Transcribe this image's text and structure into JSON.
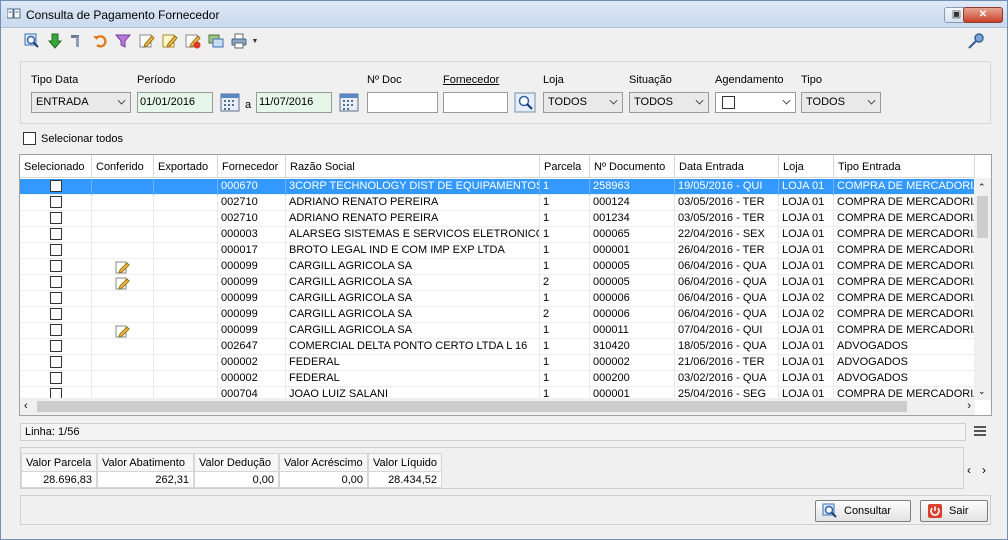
{
  "window": {
    "title": "Consulta de Pagamento Fornecedor"
  },
  "filters": {
    "tipo_data": {
      "label": "Tipo Data",
      "value": "ENTRADA"
    },
    "periodo": {
      "label": "Período",
      "from": "01/01/2016",
      "sep": "a",
      "to": "11/07/2016"
    },
    "n_doc": {
      "label": "Nº Doc",
      "value": ""
    },
    "fornecedor": {
      "label": "Fornecedor",
      "value": ""
    },
    "loja": {
      "label": "Loja",
      "value": "TODOS"
    },
    "situacao": {
      "label": "Situação",
      "value": "TODOS"
    },
    "agendamento": {
      "label": "Agendamento",
      "value": ""
    },
    "tipo": {
      "label": "Tipo",
      "value": "TODOS"
    }
  },
  "select_all": {
    "label": "Selecionar todos"
  },
  "grid": {
    "columns": [
      "Selecionado",
      "Conferido",
      "Exportado",
      "Fornecedor",
      "Razão Social",
      "Parcela",
      "Nº Documento",
      "Data Entrada",
      "Loja",
      "Tipo Entrada"
    ],
    "rows": [
      {
        "conferido": false,
        "fornecedor": "000670",
        "razao": "3CORP TECHNOLOGY DIST DE EQUIPAMENTOS",
        "parcela": "1",
        "doc": "258963",
        "data": "19/05/2016 - QUI",
        "loja": "LOJA 01",
        "tipo": "COMPRA DE MERCADORIAS"
      },
      {
        "conferido": false,
        "fornecedor": "002710",
        "razao": "ADRIANO RENATO PEREIRA",
        "parcela": "1",
        "doc": "000124",
        "data": "03/05/2016 - TER",
        "loja": "LOJA 01",
        "tipo": "COMPRA DE MERCADORIAS"
      },
      {
        "conferido": false,
        "fornecedor": "002710",
        "razao": "ADRIANO RENATO PEREIRA",
        "parcela": "1",
        "doc": "001234",
        "data": "03/05/2016 - TER",
        "loja": "LOJA 01",
        "tipo": "COMPRA DE MERCADORIAS"
      },
      {
        "conferido": false,
        "fornecedor": "000003",
        "razao": "ALARSEG SISTEMAS E SERVICOS ELETRONICOS",
        "parcela": "1",
        "doc": "000065",
        "data": "22/04/2016 - SEX",
        "loja": "LOJA 01",
        "tipo": "COMPRA DE MERCADORIAS"
      },
      {
        "conferido": false,
        "fornecedor": "000017",
        "razao": "BROTO LEGAL IND E COM IMP EXP LTDA",
        "parcela": "1",
        "doc": "000001",
        "data": "26/04/2016 - TER",
        "loja": "LOJA 01",
        "tipo": "COMPRA DE MERCADORIAS"
      },
      {
        "conferido": true,
        "fornecedor": "000099",
        "razao": "CARGILL AGRICOLA SA",
        "parcela": "1",
        "doc": "000005",
        "data": "06/04/2016 - QUA",
        "loja": "LOJA 01",
        "tipo": "COMPRA DE MERCADORIAS"
      },
      {
        "conferido": true,
        "fornecedor": "000099",
        "razao": "CARGILL AGRICOLA SA",
        "parcela": "2",
        "doc": "000005",
        "data": "06/04/2016 - QUA",
        "loja": "LOJA 01",
        "tipo": "COMPRA DE MERCADORIAS"
      },
      {
        "conferido": false,
        "fornecedor": "000099",
        "razao": "CARGILL AGRICOLA SA",
        "parcela": "1",
        "doc": "000006",
        "data": "06/04/2016 - QUA",
        "loja": "LOJA 02",
        "tipo": "COMPRA DE MERCADORIAS"
      },
      {
        "conferido": false,
        "fornecedor": "000099",
        "razao": "CARGILL AGRICOLA SA",
        "parcela": "2",
        "doc": "000006",
        "data": "06/04/2016 - QUA",
        "loja": "LOJA 02",
        "tipo": "COMPRA DE MERCADORIAS"
      },
      {
        "conferido": true,
        "fornecedor": "000099",
        "razao": "CARGILL AGRICOLA SA",
        "parcela": "1",
        "doc": "000011",
        "data": "07/04/2016 - QUI",
        "loja": "LOJA 01",
        "tipo": "COMPRA DE MERCADORIAS"
      },
      {
        "conferido": false,
        "fornecedor": "002647",
        "razao": "COMERCIAL DELTA PONTO CERTO LTDA L 16",
        "parcela": "1",
        "doc": "310420",
        "data": "18/05/2016 - QUA",
        "loja": "LOJA 01",
        "tipo": "ADVOGADOS"
      },
      {
        "conferido": false,
        "fornecedor": "000002",
        "razao": "FEDERAL",
        "parcela": "1",
        "doc": "000002",
        "data": "21/06/2016 - TER",
        "loja": "LOJA 01",
        "tipo": "ADVOGADOS"
      },
      {
        "conferido": false,
        "fornecedor": "000002",
        "razao": "FEDERAL",
        "parcela": "1",
        "doc": "000200",
        "data": "03/02/2016 - QUA",
        "loja": "LOJA 01",
        "tipo": "ADVOGADOS"
      },
      {
        "conferido": false,
        "fornecedor": "000704",
        "razao": "JOAO LUIZ SALANI",
        "parcela": "1",
        "doc": "000001",
        "data": "25/04/2016 - SEG",
        "loja": "LOJA 01",
        "tipo": "COMPRA DE MERCADORIAS"
      }
    ]
  },
  "status": {
    "text": "Linha: 1/56"
  },
  "totals": [
    {
      "label": "Valor Parcela",
      "value": "28.696,83"
    },
    {
      "label": "Valor Abatimento",
      "value": "262,31"
    },
    {
      "label": "Valor Dedução",
      "value": "0,00"
    },
    {
      "label": "Valor Acréscimo",
      "value": "0,00"
    },
    {
      "label": "Valor Líquido",
      "value": "28.434,52"
    }
  ],
  "buttons": {
    "consultar": "Consultar",
    "sair": "Sair"
  },
  "colors": {
    "selection": "#3399ff",
    "date_field": "#e6f6e9"
  }
}
